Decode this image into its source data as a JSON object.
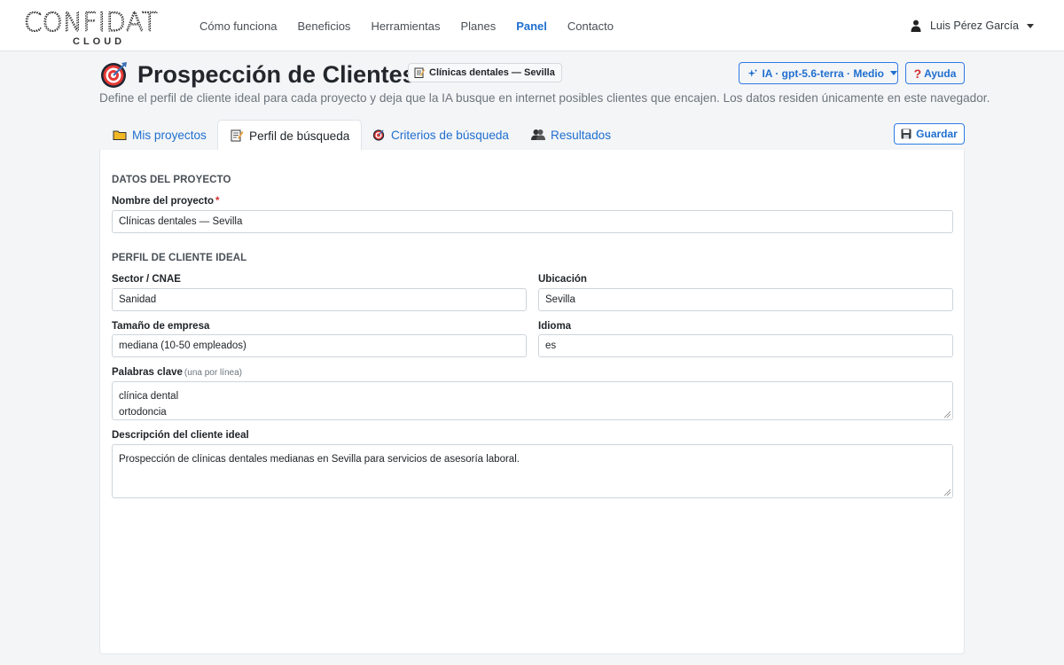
{
  "brand": {
    "name": "CONFIDAT",
    "sub": "CLOUD"
  },
  "nav": {
    "links": [
      "Cómo funciona",
      "Beneficios",
      "Herramientas",
      "Planes",
      "Panel",
      "Contacto"
    ],
    "active": "Panel",
    "user": "Luis Pérez García"
  },
  "header": {
    "title": "Prospección de Clientes",
    "project_badge": "Clínicas dentales — Sevilla",
    "ai_selector": "IA · gpt-5.6-terra · Medio",
    "help_label": "Ayuda",
    "subtitle": "Define el perfil de cliente ideal para cada proyecto y deja que la IA busque en internet posibles clientes que encajen. Los datos residen únicamente en este navegador."
  },
  "tabs": [
    {
      "label": "Mis proyectos",
      "icon": "folder-icon"
    },
    {
      "label": "Perfil de búsqueda",
      "icon": "memo-icon",
      "active": true
    },
    {
      "label": "Criterios de búsqueda",
      "icon": "target-icon"
    },
    {
      "label": "Resultados",
      "icon": "people-icon"
    }
  ],
  "save_label": "Guardar",
  "form": {
    "project_section": "DATOS DEL PROYECTO",
    "project_name_label": "Nombre del proyecto",
    "project_name_required": "*",
    "project_name_value": "Clínicas dentales — Sevilla",
    "profile_section": "PERFIL DE CLIENTE IDEAL",
    "sector_label": "Sector / CNAE",
    "sector_value": "Sanidad",
    "location_label": "Ubicación",
    "location_value": "Sevilla",
    "size_label": "Tamaño de empresa",
    "size_value": "mediana (10-50 empleados)",
    "language_label": "Idioma",
    "language_value": "es",
    "keywords_label": "Palabras clave",
    "keywords_hint": "(una por línea)",
    "keywords": [
      "clínica dental",
      "ortodoncia"
    ],
    "description_label": "Descripción del cliente ideal",
    "description_value": "Prospección de clínicas dentales medianas en Sevilla para servicios de asesoría laboral."
  },
  "colors": {
    "accent": "#1f6fcf",
    "required": "#d0312d",
    "muted": "#6c757d"
  }
}
